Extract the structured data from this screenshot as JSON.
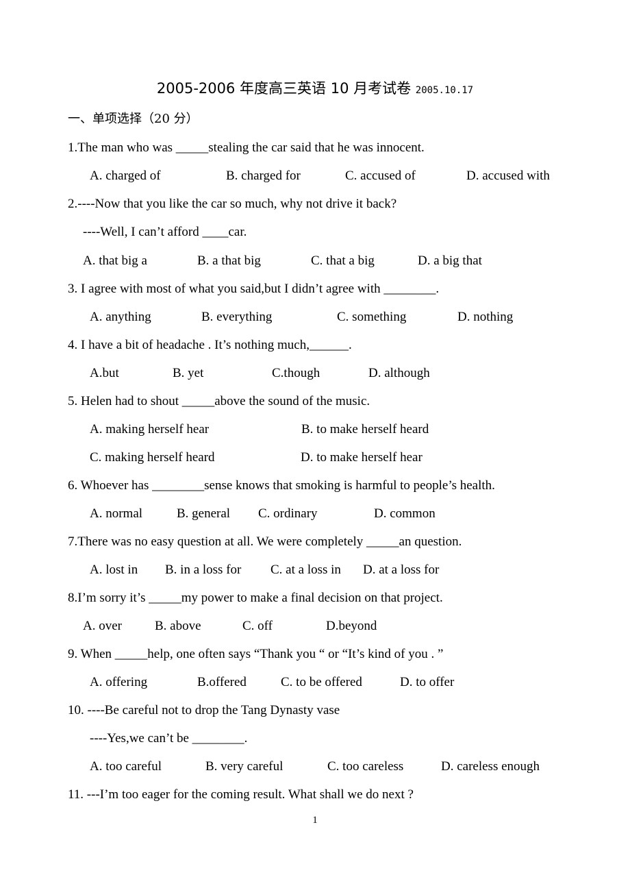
{
  "document": {
    "title": "2005-2006 年度高三英语 10 月考试卷",
    "date": "2005.10.17",
    "section_heading": "一、单项选择（20 分）",
    "page_number": "1"
  },
  "questions": [
    {
      "number": 1,
      "lines": [
        "1.The man who was _____stealing the car said that he was innocent."
      ],
      "options": [
        "A. charged of",
        "B. charged for",
        "C. accused of",
        "D. accused with"
      ]
    },
    {
      "number": 2,
      "lines": [
        "2.----Now that you like the car so much, why not drive it back?",
        "----Well, I can’t afford ____car."
      ],
      "options": [
        "A. that big a",
        "B. a that big",
        "C. that a big",
        "D. a big that"
      ]
    },
    {
      "number": 3,
      "lines": [
        "3. I agree with most of what you said,but I didn’t agree with ________."
      ],
      "options": [
        "A. anything",
        "B. everything",
        "C. something",
        "D. nothing"
      ]
    },
    {
      "number": 4,
      "lines": [
        "4. I have a bit of headache . It’s nothing much,______."
      ],
      "options": [
        "A.but",
        "B. yet",
        "C.though",
        "D. although"
      ]
    },
    {
      "number": 5,
      "lines": [
        "5. Helen had to shout _____above the sound of the music."
      ],
      "options": [
        "A. making herself hear",
        "B. to make herself heard",
        "C. making herself heard",
        "D. to make herself hear"
      ]
    },
    {
      "number": 6,
      "lines": [
        "6. Whoever has ________sense knows that smoking is harmful to people’s health."
      ],
      "options": [
        "A. normal",
        "B. general",
        "C. ordinary",
        "D. common"
      ]
    },
    {
      "number": 7,
      "lines": [
        "7.There was no easy question at all. We were completely _____an question."
      ],
      "options": [
        "A. lost in",
        "B. in a loss for",
        "C. at a loss in",
        "D. at a loss for"
      ]
    },
    {
      "number": 8,
      "lines": [
        "8.I’m sorry it’s _____my power to make a final decision on that project."
      ],
      "options": [
        "A. over",
        "B. above",
        "C. off",
        "D.beyond"
      ]
    },
    {
      "number": 9,
      "lines": [
        "9. When _____help, one often says “Thank you “ or “It’s kind of you . ”"
      ],
      "options": [
        "A. offering",
        "B.offered",
        "C. to be offered",
        "D. to offer"
      ]
    },
    {
      "number": 10,
      "lines": [
        "10. ----Be careful not to drop the Tang Dynasty vase",
        "----Yes,we can’t be ________."
      ],
      "options": [
        "A. too careful",
        "B. very careful",
        "C. too careless",
        "D. careless enough"
      ]
    },
    {
      "number": 11,
      "lines": [
        "11. ---I’m too eager for the coming result. What shall we do next ?"
      ],
      "options": []
    }
  ]
}
